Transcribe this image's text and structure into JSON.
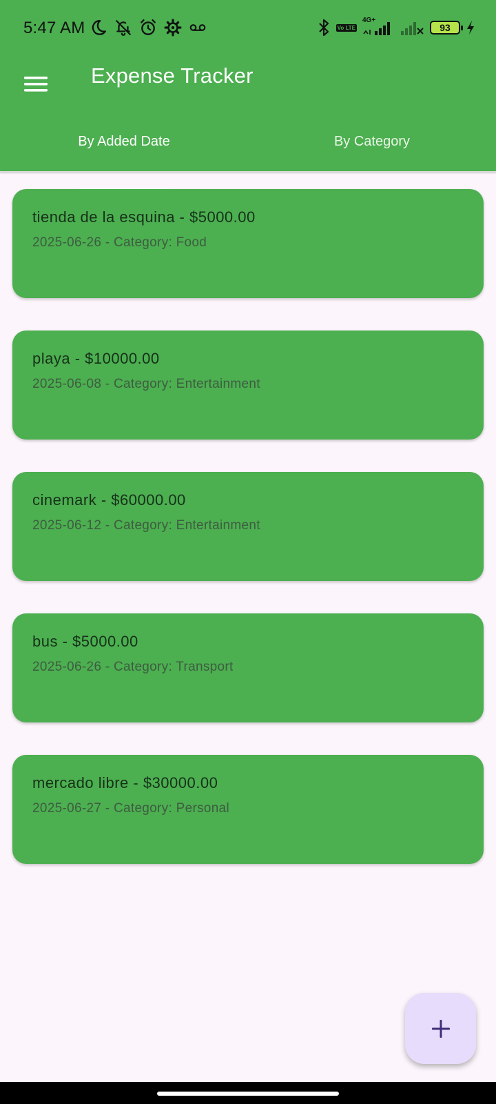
{
  "status_bar": {
    "time": "5:47 AM",
    "left_icons": [
      "moon-icon",
      "bell-off-icon",
      "alarm-icon",
      "settings-cog-icon",
      "voicemail-icon"
    ],
    "right_icons": [
      "bluetooth-icon",
      "volte-icon",
      "signal-4g-icon",
      "signal-no-service-icon",
      "battery-icon",
      "charging-icon"
    ],
    "volte_label": "Vo LTE",
    "network_label": "4G+",
    "battery_level": "93"
  },
  "app_bar": {
    "menu_icon": "hamburger-menu-icon",
    "title": "Expense Tracker"
  },
  "tabs": [
    {
      "label": "By Added Date",
      "selected": true
    },
    {
      "label": "By Category",
      "selected": false
    }
  ],
  "expenses": [
    {
      "title": "tienda de la esquina - $5000.00",
      "subtitle": "2025-06-26 - Category: Food"
    },
    {
      "title": "playa - $10000.00",
      "subtitle": "2025-06-08 - Category: Entertainment"
    },
    {
      "title": "cinemark - $60000.00",
      "subtitle": "2025-06-12 - Category: Entertainment"
    },
    {
      "title": "bus - $5000.00",
      "subtitle": "2025-06-26 - Category: Transport"
    },
    {
      "title": "mercado libre - $30000.00",
      "subtitle": "2025-06-27 - Category: Personal"
    }
  ],
  "fab": {
    "icon": "plus-icon"
  },
  "colors": {
    "primary": "#4caf50",
    "background": "#fcf6fc",
    "fab": "#e7dcfb",
    "fab_icon": "#3f2f7a"
  }
}
